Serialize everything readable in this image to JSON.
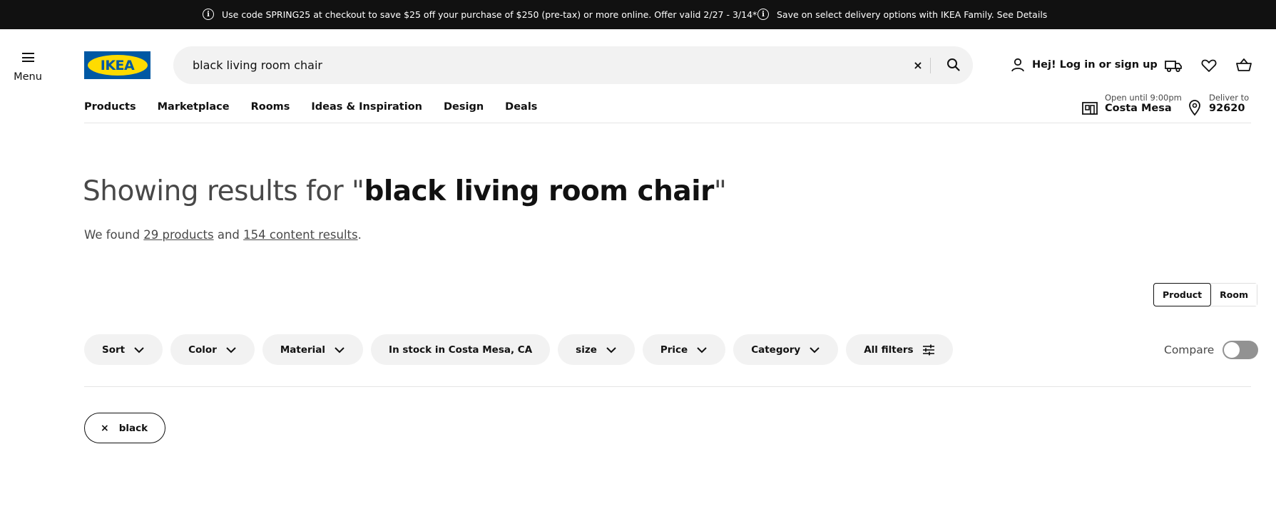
{
  "promo": {
    "message_1": "Use code SPRING25 at checkout to save $25 off your purchase of $250 (pre-tax) or more online. Offer valid 2/27 - 3/14*",
    "message_2": "Save on select delivery options with IKEA Family. See Details",
    "info_icon": "info-icon"
  },
  "header": {
    "menu_label": "Menu",
    "logo_text": "IKEA",
    "search": {
      "value": "black living room chair",
      "clear_glyph": "×"
    },
    "login_label": "Hej! Log in or sign up",
    "icons": [
      "user-icon",
      "truck-icon",
      "heart-icon",
      "cart-icon"
    ]
  },
  "nav": {
    "items": [
      "Products",
      "Marketplace",
      "Rooms",
      "Ideas & Inspiration",
      "Design",
      "Deals"
    ],
    "store": {
      "hours": "Open until 9:00pm",
      "name": "Costa Mesa"
    },
    "deliver": {
      "label": "Deliver to",
      "zip": "92620"
    }
  },
  "main": {
    "heading_prefix": "Showing results for \"",
    "heading_query": "black living room chair",
    "heading_suffix": "\"",
    "found": {
      "pre": "We found ",
      "products_link": "29 products",
      "mid": " and ",
      "content_link": "154 content results",
      "post": "."
    },
    "view_toggle": {
      "product": "Product",
      "room": "Room",
      "active": "Product"
    },
    "filters": [
      "Sort",
      "Color",
      "Material",
      "In stock in Costa Mesa, CA",
      "size",
      "Price",
      "Category",
      "All filters"
    ],
    "compare_label": "Compare",
    "compare_on": false,
    "active_chip": {
      "label": "black",
      "remove_glyph": "×"
    }
  }
}
